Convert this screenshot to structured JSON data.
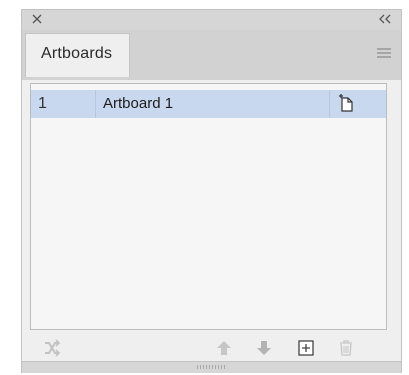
{
  "panel": {
    "tab_label": "Artboards",
    "icons": {
      "close": "close-icon",
      "collapse": "double-chevron-left-icon",
      "menu": "hamburger-menu-icon"
    }
  },
  "artboards": [
    {
      "number": "1",
      "name": "Artboard 1",
      "selected": true,
      "options_icon": "artboard-options-icon"
    }
  ],
  "footer": {
    "icons": [
      "rearrange-artboards-icon",
      "move-up-icon",
      "move-down-icon",
      "new-artboard-icon",
      "delete-artboard-icon"
    ]
  },
  "colors": {
    "selection": "#c8d9ef",
    "panel_bg": "#efefef",
    "chrome": "#d8d8d8"
  }
}
